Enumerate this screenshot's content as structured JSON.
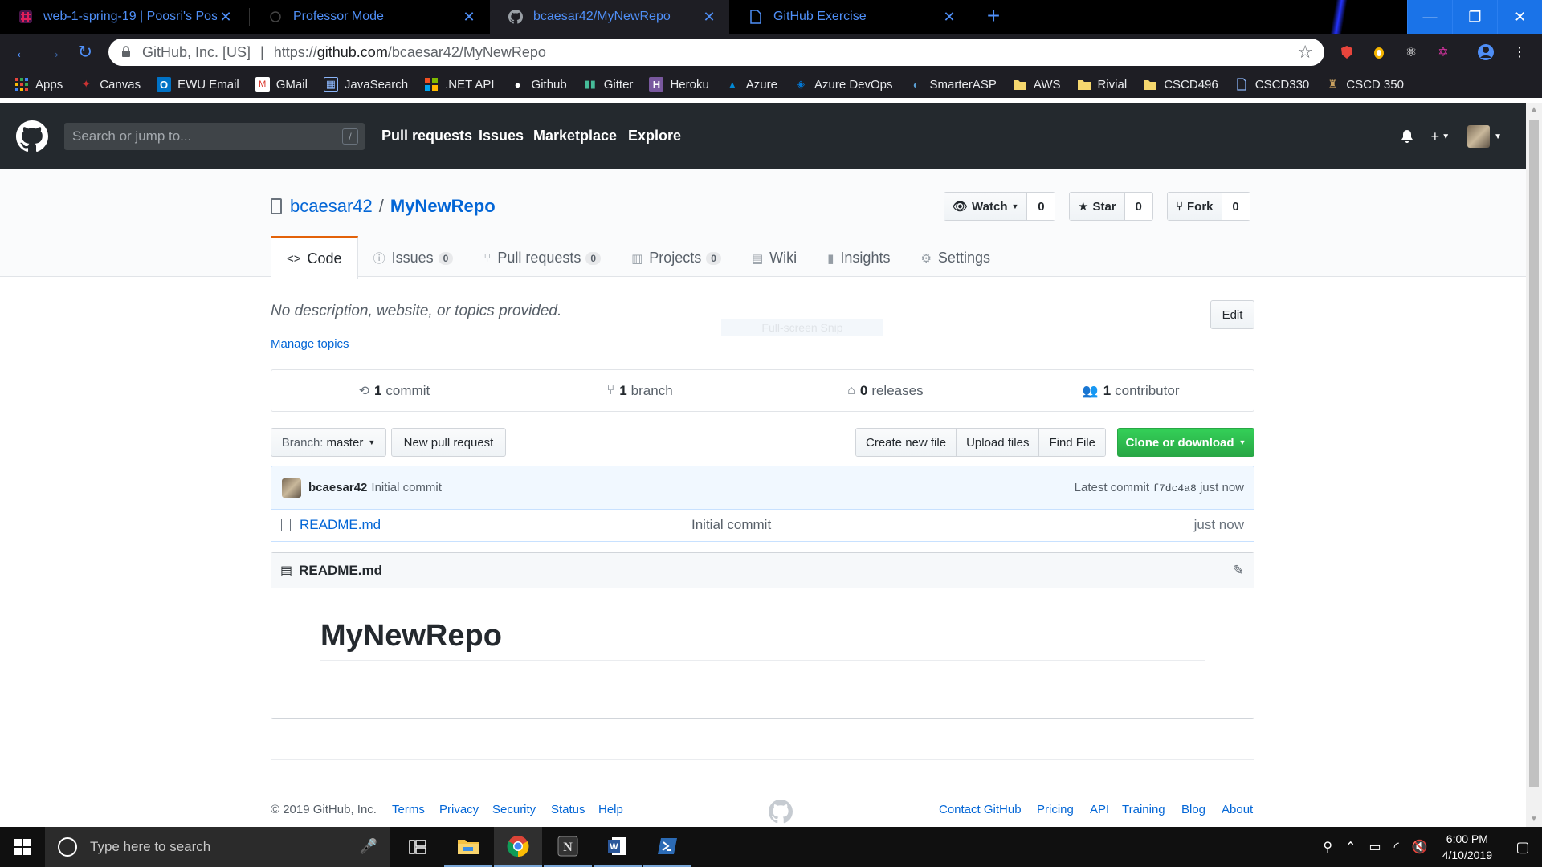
{
  "browser": {
    "tabs": [
      {
        "title": "web-1-spring-19 | Poosri's Posse",
        "close": "✕"
      },
      {
        "title": "Professor Mode",
        "close": "✕"
      },
      {
        "title": "bcaesar42/MyNewRepo",
        "close": "✕"
      },
      {
        "title": "GitHub Exercise",
        "close": "✕"
      }
    ],
    "new_tab": "+",
    "window_controls": {
      "minimize": "—",
      "restore": "❐",
      "close": "✕"
    },
    "omnibox": {
      "org": "GitHub, Inc. [US]",
      "separator": "|",
      "url_prefix": "https://",
      "url_host": "github.com",
      "url_path": "/bcaesar42/MyNewRepo"
    },
    "bookmarks": [
      {
        "label": "Apps",
        "icon": "apps-grid-icon",
        "color": "#e8453c"
      },
      {
        "label": "Canvas",
        "icon": "canvas-icon",
        "color": "#b22"
      },
      {
        "label": "EWU Email",
        "icon": "outlook-icon",
        "color": "#0072c6"
      },
      {
        "label": "GMail",
        "icon": "gmail-icon",
        "color": "#d93025"
      },
      {
        "label": "JavaSearch",
        "icon": "table-icon",
        "color": "#5a7fb8"
      },
      {
        "label": ".NET API",
        "icon": "microsoft-icon",
        "color": "#f25022"
      },
      {
        "label": "Github",
        "icon": "github-icon",
        "color": "#ffffff"
      },
      {
        "label": "Gitter",
        "icon": "gitter-icon",
        "color": "#46bc99"
      },
      {
        "label": "Heroku",
        "icon": "heroku-icon",
        "color": "#79589f"
      },
      {
        "label": "Azure",
        "icon": "azure-icon",
        "color": "#0089d6"
      },
      {
        "label": "Azure DevOps",
        "icon": "devops-icon",
        "color": "#0078d7"
      },
      {
        "label": "SmarterASP",
        "icon": "smarterasp-icon",
        "color": "#5a9fd4"
      },
      {
        "label": "AWS",
        "icon": "folder-icon",
        "color": "#f5d76e"
      },
      {
        "label": "Rivial",
        "icon": "folder-icon",
        "color": "#f5d76e"
      },
      {
        "label": "CSCD496",
        "icon": "folder-icon",
        "color": "#f5d76e"
      },
      {
        "label": "CSCD330",
        "icon": "page-icon",
        "color": "#8ab4f8"
      },
      {
        "label": "CSCD 350",
        "icon": "bookmark-icon",
        "color": "#c8a060"
      }
    ]
  },
  "github": {
    "search_placeholder": "Search or jump to...",
    "search_hotkey": "/",
    "nav": [
      "Pull requests",
      "Issues",
      "Marketplace",
      "Explore"
    ],
    "repo": {
      "owner": "bcaesar42",
      "slash": "/",
      "name": "MyNewRepo",
      "watch": {
        "label": "Watch",
        "count": "0"
      },
      "star": {
        "label": "Star",
        "count": "0"
      },
      "fork": {
        "label": "Fork",
        "count": "0"
      }
    },
    "tabs": [
      {
        "label": "Code",
        "icon": "<>",
        "count": null
      },
      {
        "label": "Issues",
        "icon": "ⓘ",
        "count": "0"
      },
      {
        "label": "Pull requests",
        "icon": "⑂",
        "count": "0"
      },
      {
        "label": "Projects",
        "icon": "▥",
        "count": "0"
      },
      {
        "label": "Wiki",
        "icon": "▤",
        "count": null
      },
      {
        "label": "Insights",
        "icon": "▮",
        "count": null
      },
      {
        "label": "Settings",
        "icon": "⚙",
        "count": null
      }
    ],
    "description": "No description, website, or topics provided.",
    "manage_topics": "Manage topics",
    "edit": "Edit",
    "snip_overlay": "Full-screen Snip",
    "numbers": [
      {
        "count": "1",
        "label": "commit"
      },
      {
        "count": "1",
        "label": "branch"
      },
      {
        "count": "0",
        "label": "releases"
      },
      {
        "count": "1",
        "label": "contributor"
      }
    ],
    "branch_label": "Branch:",
    "branch_name": "master",
    "new_pull_request": "New pull request",
    "file_actions": [
      "Create new file",
      "Upload files",
      "Find File"
    ],
    "clone": "Clone or download",
    "commit": {
      "author": "bcaesar42",
      "message": "Initial commit",
      "latest_label": "Latest commit",
      "sha": "f7dc4a8",
      "age": "just now"
    },
    "files": [
      {
        "name": "README.md",
        "message": "Initial commit",
        "age": "just now"
      }
    ],
    "readme": {
      "title": "README.md",
      "heading": "MyNewRepo"
    },
    "footer": {
      "copyright": "© 2019 GitHub, Inc.",
      "left_links": [
        "Terms",
        "Privacy",
        "Security",
        "Status",
        "Help"
      ],
      "right_links": [
        "Contact GitHub",
        "Pricing",
        "API",
        "Training",
        "Blog",
        "About"
      ]
    }
  },
  "taskbar": {
    "search_placeholder": "Type here to search",
    "time": "6:00 PM",
    "date": "4/10/2019"
  }
}
